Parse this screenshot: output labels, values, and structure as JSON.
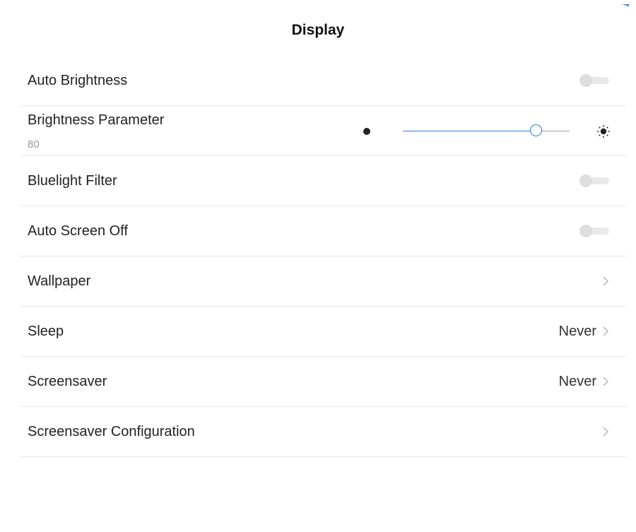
{
  "header": {
    "title": "Display"
  },
  "settings": {
    "auto_brightness": {
      "label": "Auto Brightness",
      "enabled": false
    },
    "brightness": {
      "label": "Brightness Parameter",
      "value": "80",
      "level": 0.8,
      "dim_icon": "dot-icon",
      "bright_icon": "sun-icon"
    },
    "bluelight_filter": {
      "label": "Bluelight Filter",
      "enabled": false
    },
    "auto_screen_off": {
      "label": "Auto Screen Off",
      "enabled": false
    },
    "wallpaper": {
      "label": "Wallpaper"
    },
    "sleep": {
      "label": "Sleep",
      "value": "Never"
    },
    "screensaver": {
      "label": "Screensaver",
      "value": "Never"
    },
    "screensaver_configuration": {
      "label": "Screensaver Configuration"
    }
  },
  "colors": {
    "accent": "#2b7de9",
    "toggle_off_track": "#e9e9e9",
    "toggle_off_knob": "#dedede",
    "divider": "#e6e6e6"
  }
}
